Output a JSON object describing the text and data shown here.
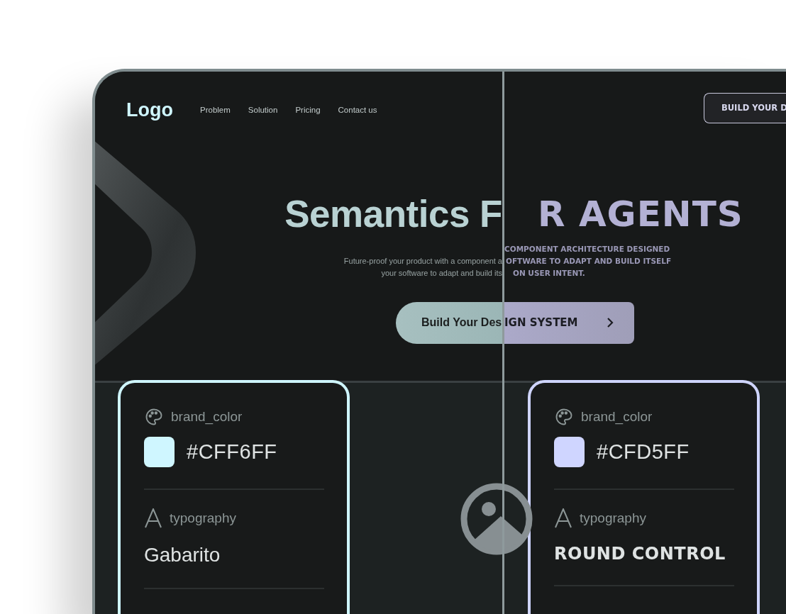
{
  "nav": {
    "logo": "Logo",
    "links": [
      "Problem",
      "Solution",
      "Pricing",
      "Contact us"
    ],
    "cta": "BUILD YOUR D"
  },
  "hero": {
    "title_left": "Semantics F",
    "title_right": "R AGENTS",
    "subtitle_left": [
      "Future-proof your product with a component a",
      "your software to adapt and build its"
    ],
    "subtitle_right": [
      "COMPONENT ARCHITECTURE DESIGNED",
      "OFTWARE TO ADAPT AND BUILD ITSELF",
      "ON USER INTENT."
    ],
    "button_left": "Build Your Des",
    "button_right": "IGN SYSTEM"
  },
  "cards": [
    {
      "kind": "sans",
      "label": "brand_color",
      "color": "#cff6ff",
      "value": "#CFF6FF",
      "type_label": "typography",
      "font": "Gabarito"
    },
    {
      "kind": "display",
      "label": "brand_color",
      "color": "#cfd5ff",
      "value": "#CFD5FF",
      "type_label": "typography",
      "font": "ROUND CONTROL"
    }
  ]
}
